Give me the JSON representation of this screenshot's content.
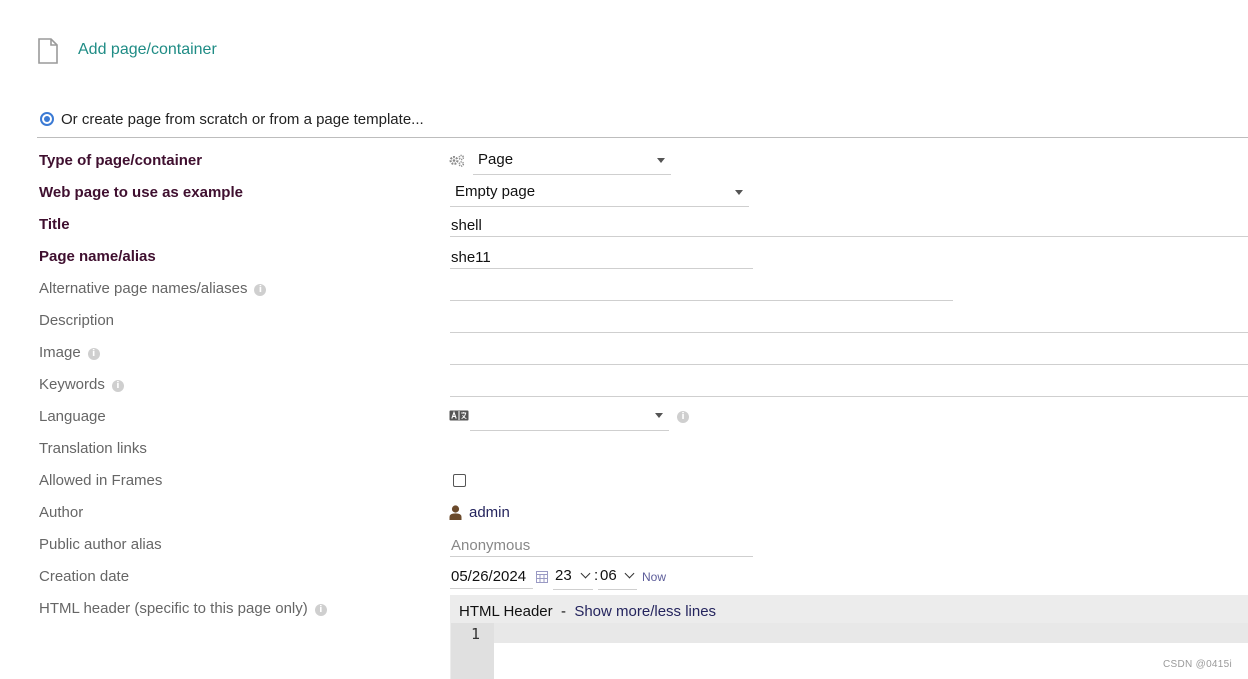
{
  "header": {
    "add_link": "Add page/container",
    "radio_label": "Or create page from scratch or from a page template..."
  },
  "fields": {
    "type": {
      "label": "Type of page/container",
      "value": "Page"
    },
    "example": {
      "label": "Web page to use as example",
      "value": "Empty page"
    },
    "title": {
      "label": "Title",
      "value": "shell"
    },
    "alias": {
      "label": "Page name/alias",
      "value": "she11"
    },
    "alt_names": {
      "label": "Alternative page names/aliases",
      "value": ""
    },
    "description": {
      "label": "Description",
      "value": ""
    },
    "image": {
      "label": "Image",
      "value": ""
    },
    "keywords": {
      "label": "Keywords",
      "value": ""
    },
    "language": {
      "label": "Language",
      "value": ""
    },
    "translation_links": {
      "label": "Translation links"
    },
    "allowed_frames": {
      "label": "Allowed in Frames",
      "checked": false
    },
    "author": {
      "label": "Author",
      "value": "admin"
    },
    "public_alias": {
      "label": "Public author alias",
      "placeholder": "Anonymous"
    },
    "creation_date": {
      "label": "Creation date",
      "date": "05/26/2024",
      "hour": "23",
      "minute": "06",
      "separator": ":",
      "now": "Now"
    },
    "html_header": {
      "label": "HTML header (specific to this page only)"
    }
  },
  "editor": {
    "title": "HTML Header",
    "sep": "-",
    "toggle": "Show more/less lines",
    "line_number": "1"
  },
  "watermark": "CSDN @0415i",
  "icons": {
    "file": "file-icon",
    "gear": "gears-icon",
    "language": "language-icon",
    "user": "user-icon",
    "calendar": "calendar-icon",
    "info": "info-icon"
  },
  "colors": {
    "link_teal": "#1f8c85",
    "required_label": "#3f0f2f",
    "radio": "#3b7ad4",
    "author": "#6b4a2b"
  }
}
